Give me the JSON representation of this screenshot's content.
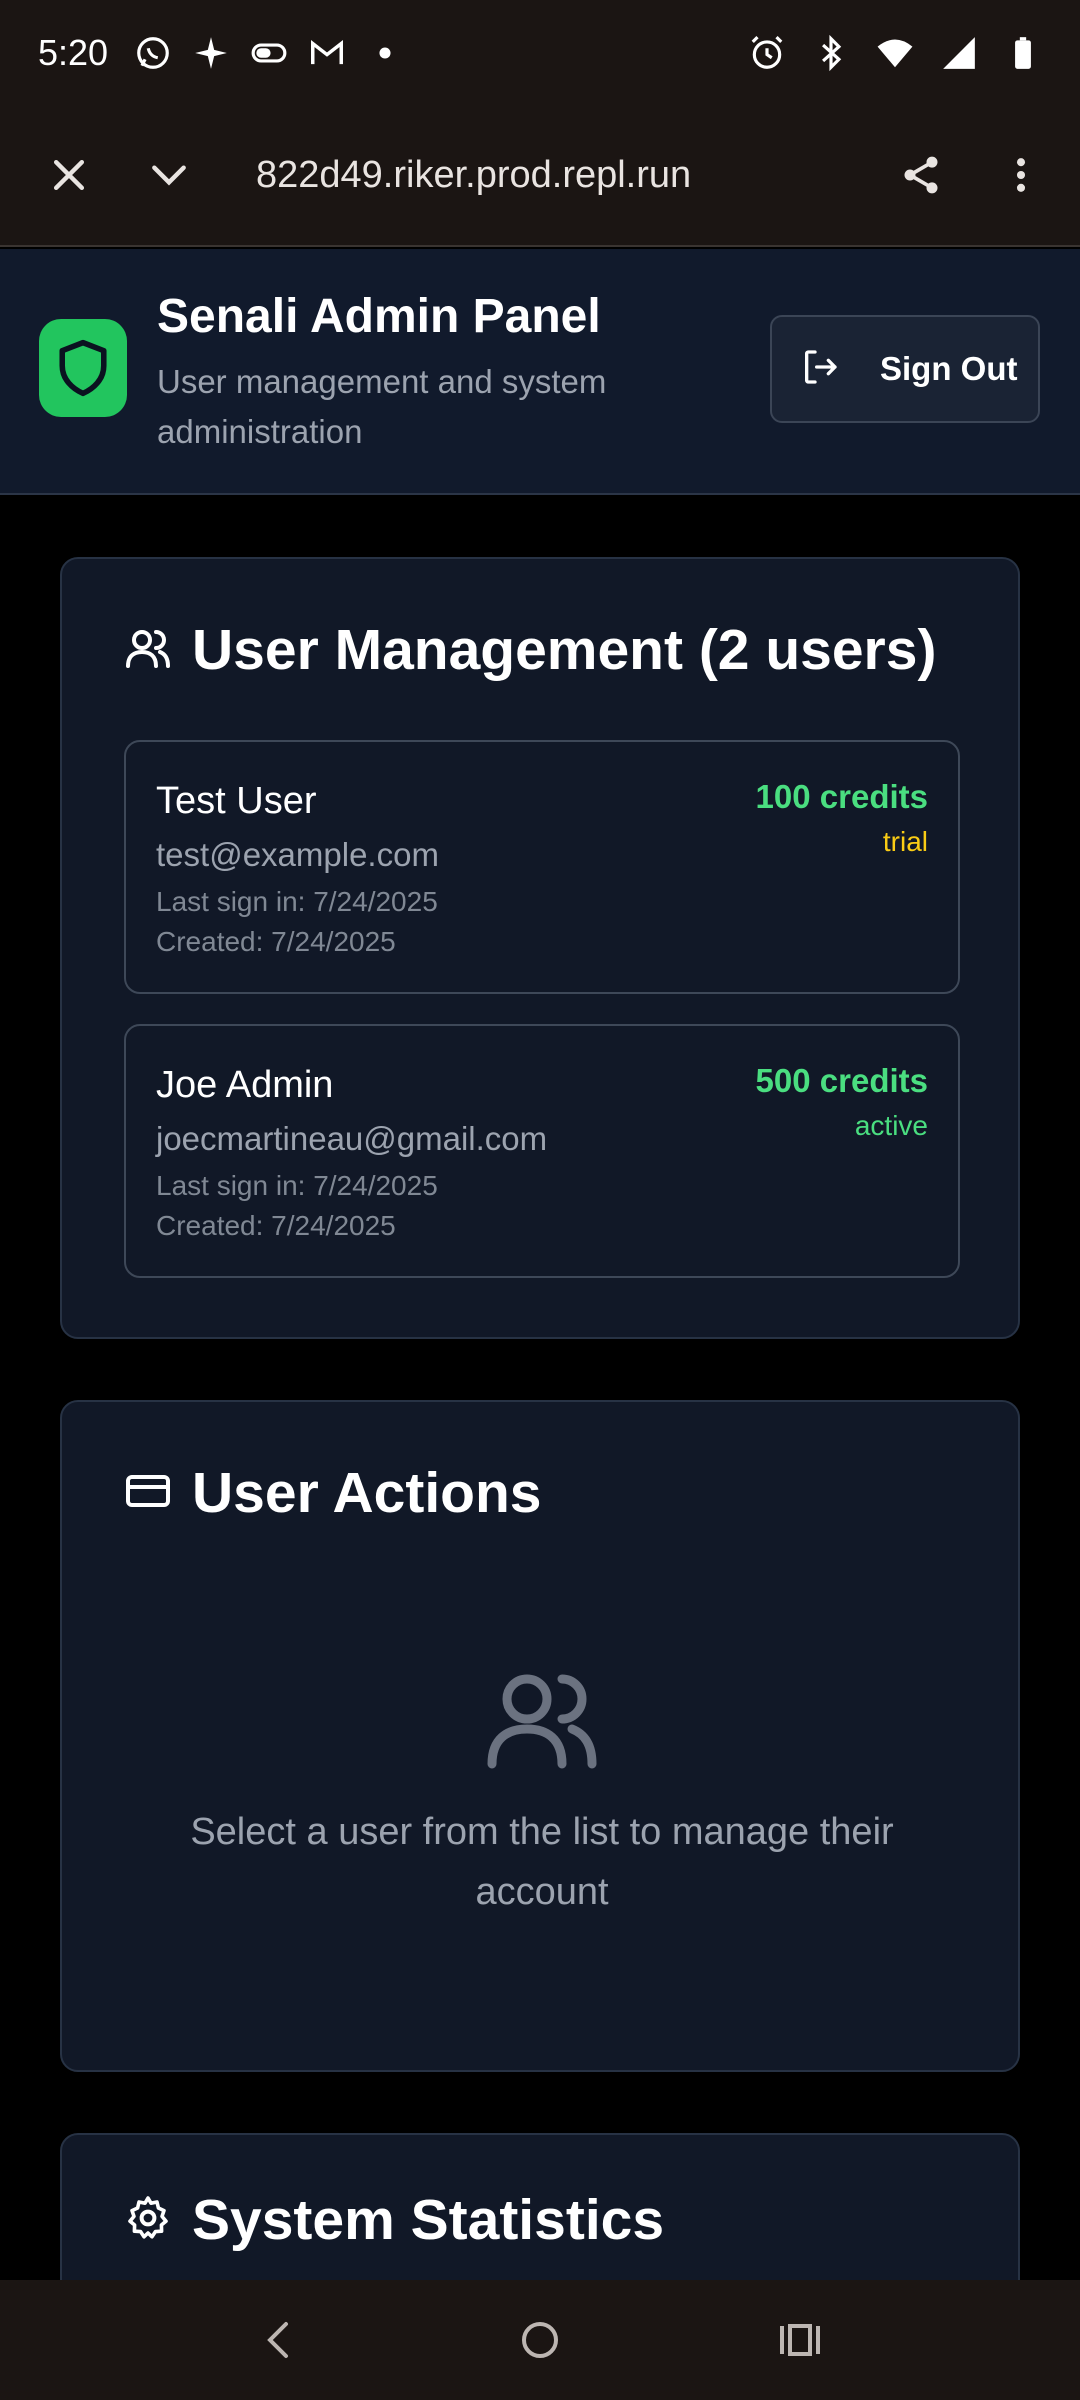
{
  "status_bar": {
    "time": "5:20",
    "left_icons": [
      "whatsapp-icon",
      "sparkle-icon",
      "toggle-icon",
      "gmail-icon",
      "dot-icon"
    ],
    "right_icons": [
      "alarm-icon",
      "bluetooth-icon",
      "wifi-icon",
      "signal-icon",
      "battery-icon"
    ]
  },
  "browser": {
    "url": "822d49.riker.prod.repl.run"
  },
  "header": {
    "title": "Senali Admin Panel",
    "subtitle": "User management and system administration",
    "sign_out_label": "Sign Out",
    "brand_color": "#22c55e"
  },
  "user_management": {
    "title": "User Management (2 users)",
    "users": [
      {
        "name": "Test User",
        "email": "test@example.com",
        "last_sign_in": "Last sign in: 7/24/2025",
        "created": "Created: 7/24/2025",
        "credits": "100 credits",
        "status": "trial",
        "status_color": "#facc15"
      },
      {
        "name": "Joe Admin",
        "email": "joecmartineau@gmail.com",
        "last_sign_in": "Last sign in: 7/24/2025",
        "created": "Created: 7/24/2025",
        "credits": "500 credits",
        "status": "active",
        "status_color": "#4ade80"
      }
    ]
  },
  "user_actions": {
    "title": "User Actions",
    "empty_message": "Select a user from the list to manage their account"
  },
  "system_statistics": {
    "title": "System Statistics"
  },
  "colors": {
    "credits": "#4ade80",
    "card_bg": "#111827",
    "header_bg": "#111a2c"
  }
}
